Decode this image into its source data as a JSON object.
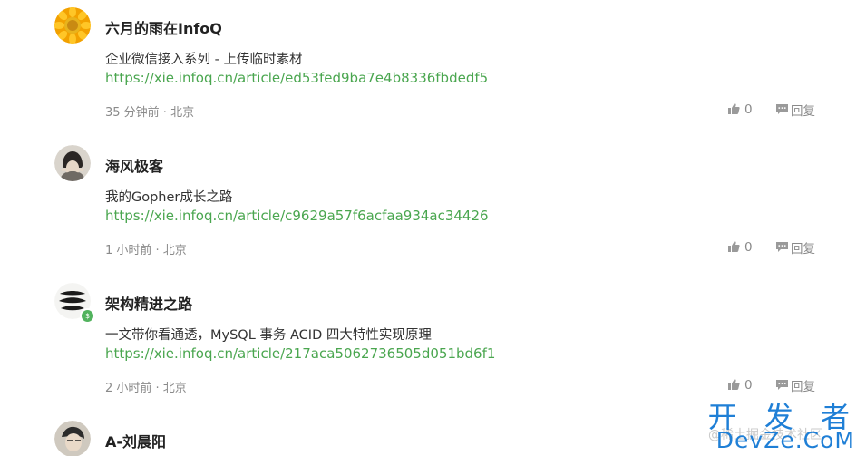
{
  "comments": [
    {
      "name": "六月的雨在InfoQ",
      "content": "企业微信接入系列 - 上传临时素材",
      "link": "https://xie.infoq.cn/article/ed53fed9ba7e4b8336fbdedf5",
      "meta": "35 分钟前 · 北京",
      "likes": "0",
      "reply": "回复"
    },
    {
      "name": "海风极客",
      "content": "我的Gopher成长之路",
      "link": "https://xie.infoq.cn/article/c9629a57f6acfaa934ac34426",
      "meta": "1 小时前 · 北京",
      "likes": "0",
      "reply": "回复"
    },
    {
      "name": "架构精进之路",
      "content": "一文带你看通透，MySQL 事务 ACID 四大特性实现原理",
      "link": "https://xie.infoq.cn/article/217aca5062736505d051bd6f1",
      "meta": "2 小时前 · 北京",
      "likes": "0",
      "reply": "回复"
    },
    {
      "name": "A-刘晨阳"
    }
  ],
  "watermark": {
    "top": "开 发 者",
    "bottom": "DevZe.CoM",
    "faint": "@稀土掘金技术社区"
  },
  "colors": {
    "link": "#4aa64f",
    "meta": "#8a8a8a",
    "watermark": "#1f7fd6"
  }
}
